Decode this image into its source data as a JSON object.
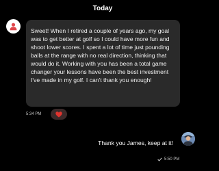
{
  "thread": {
    "day_label": "Today"
  },
  "incoming": {
    "avatar_icon": "person-icon",
    "text": "Sweet! When I retired a couple of years ago, my goal was to get better at golf so I could have more fun and shoot lower scores. I spent a lot of time just pounding balls at the range with no real direction, thinking that would do it. Working with you has been a total game changer your lessons have been the best investment I've made in my golf. I can't thank you enough!",
    "time": "5:34 PM",
    "reaction_icon": "heart-icon",
    "reaction_color": "#e0332e"
  },
  "outgoing": {
    "text": "Thank you James, keep at it!",
    "avatar_icon": "user-photo-icon",
    "status_icon": "check-icon",
    "time": "5:50 PM"
  },
  "colors": {
    "background": "#000000",
    "bubble_incoming": "#2a2a2a",
    "avatar_accent": "#e0474c"
  }
}
